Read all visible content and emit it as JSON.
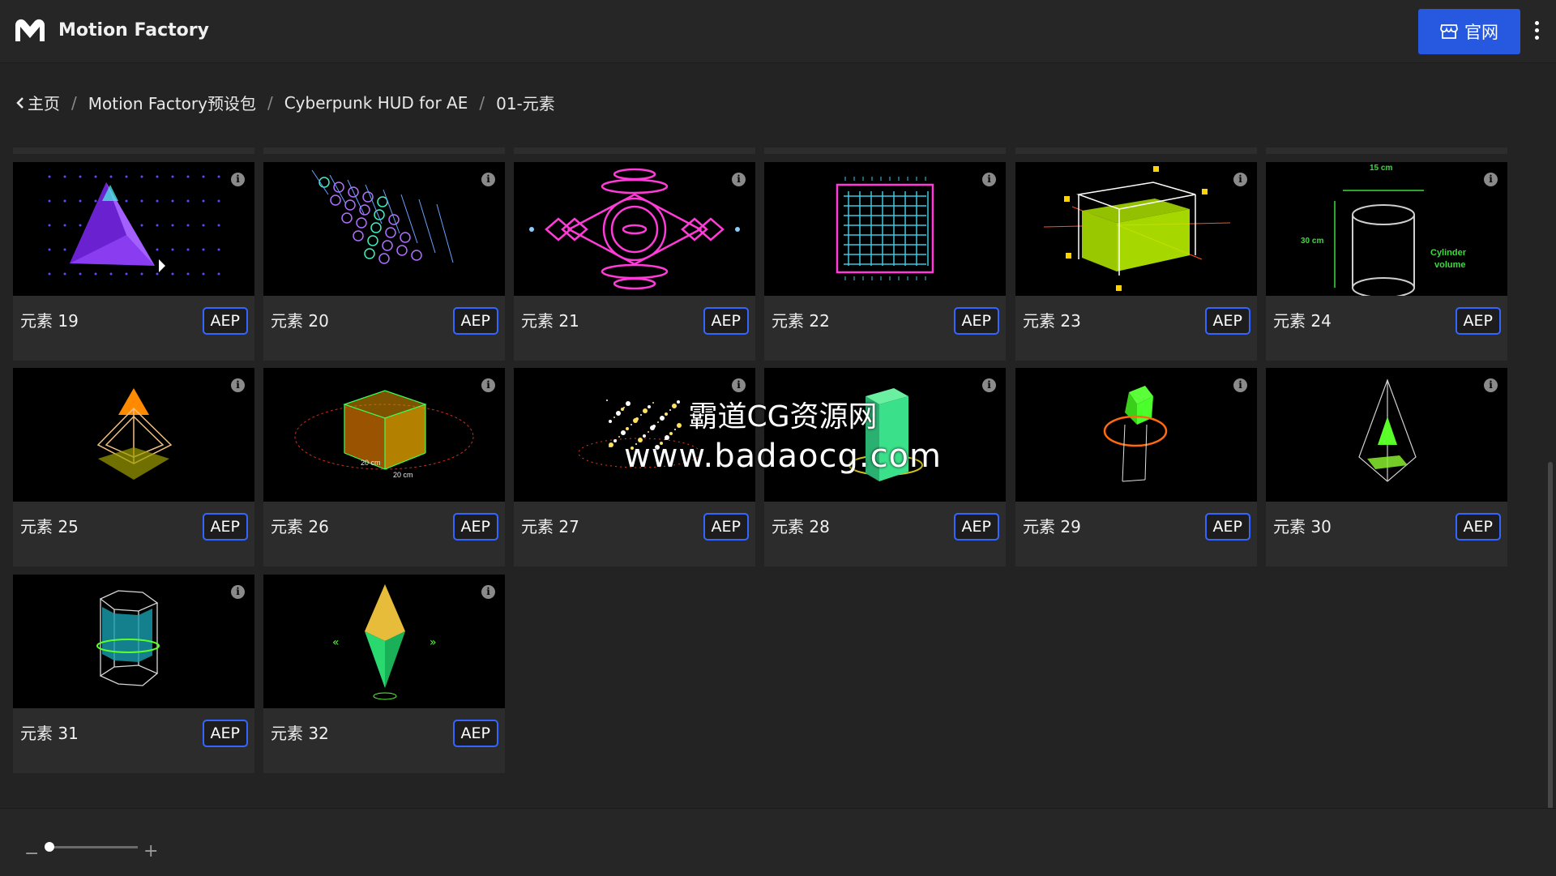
{
  "app": {
    "title": "Motion Factory",
    "logo_icon": "motion-factory-logo-icon"
  },
  "header": {
    "site_button_label": "官网",
    "site_button_icon": "store-icon",
    "menu_icon": "kebab-menu-icon"
  },
  "breadcrumb": {
    "items": [
      "主页",
      "Motion Factory预设包",
      "Cyberpunk HUD for AE",
      "01-元素"
    ],
    "separator": "/"
  },
  "cards": [
    {
      "label": "元素 19",
      "badge": "AEP",
      "thumb": "purple-pyramid"
    },
    {
      "label": "元素 20",
      "badge": "AEP",
      "thumb": "hex-network"
    },
    {
      "label": "元素 21",
      "badge": "AEP",
      "thumb": "pink-diamond-rings"
    },
    {
      "label": "元素 22",
      "badge": "AEP",
      "thumb": "pink-grid"
    },
    {
      "label": "元素 23",
      "badge": "AEP",
      "thumb": "green-box"
    },
    {
      "label": "元素 24",
      "badge": "AEP",
      "thumb": "green-cylinder",
      "overlay_text": [
        "15 cm",
        "30 cm",
        "Cylinder",
        "volume"
      ]
    },
    {
      "label": "元素 25",
      "badge": "AEP",
      "thumb": "orange-pyramid"
    },
    {
      "label": "元素 26",
      "badge": "AEP",
      "thumb": "orange-cube",
      "overlay_text": [
        "20 cm",
        "20 cm"
      ]
    },
    {
      "label": "元素 27",
      "badge": "AEP",
      "thumb": "gold-particles"
    },
    {
      "label": "元素 28",
      "badge": "AEP",
      "thumb": "green-column"
    },
    {
      "label": "元素 29",
      "badge": "AEP",
      "thumb": "green-prism-ring"
    },
    {
      "label": "元素 30",
      "badge": "AEP",
      "thumb": "green-spire"
    },
    {
      "label": "元素 31",
      "badge": "AEP",
      "thumb": "cyan-hex-prism"
    },
    {
      "label": "元素 32",
      "badge": "AEP",
      "thumb": "green-crystal"
    }
  ],
  "watermark": {
    "line1": "霸道CG资源网",
    "line2": "www.badaocg.com"
  },
  "zoom": {
    "minus": "−",
    "plus": "+",
    "level": 0.03
  },
  "colors": {
    "accent": "#2758e0",
    "badge_border": "#3466ff",
    "background": "#232323",
    "card": "#2c2c2c"
  }
}
